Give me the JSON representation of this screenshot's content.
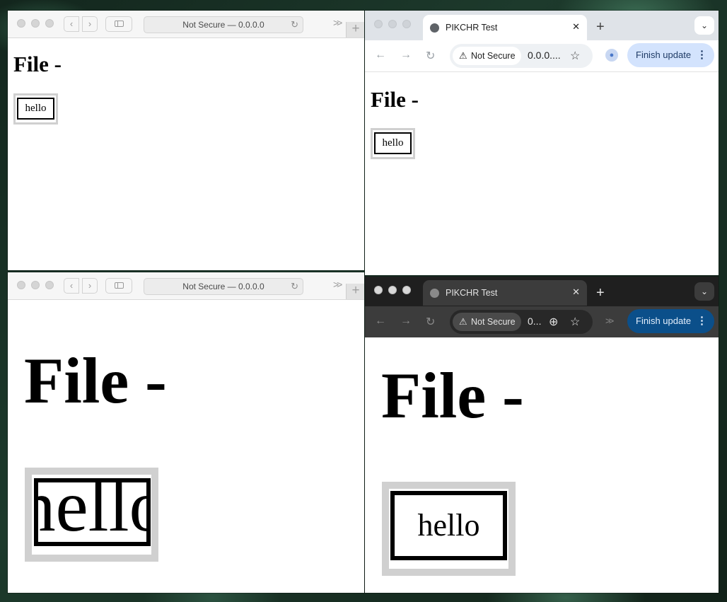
{
  "safari_top": {
    "url": "Not Secure — 0.0.0.0",
    "heading": "File -",
    "box_text": "hello"
  },
  "safari_bottom": {
    "url": "Not Secure — 0.0.0.0",
    "heading": "File -",
    "box_text": "hello"
  },
  "chrome_top": {
    "tab_title": "PIKCHR Test",
    "security_label": "Not Secure",
    "url": "0.0.0....",
    "update_label": "Finish update",
    "heading": "File -",
    "box_text": "hello"
  },
  "chrome_bottom": {
    "tab_title": "PIKCHR Test",
    "security_label": "Not Secure",
    "url": "0...",
    "update_label": "Finish update",
    "heading": "File -",
    "box_text": "hello"
  },
  "icons": {
    "back": "‹",
    "forward": "›",
    "reload": "↻",
    "more": ">>",
    "plus": "+",
    "close": "✕",
    "dropdown": "⌄",
    "star": "☆",
    "warning": "⚠",
    "kebab": "⋮",
    "zoom": "⊕",
    "arrow_back": "←",
    "arrow_forward": "→"
  },
  "colors": {
    "chrome_light_tabbar": "#dfe3e8",
    "chrome_dark_tabbar": "#1f1f1f",
    "chrome_dark_toolbar": "#3c3c3c",
    "update_light": "#d3e3fd",
    "update_dark": "#0b4f8a"
  }
}
